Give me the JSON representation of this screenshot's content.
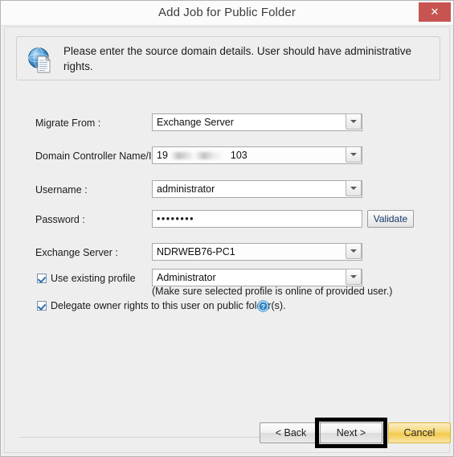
{
  "window": {
    "title": "Add Job for Public Folder",
    "close_label": "✕",
    "close_icon": "close-icon"
  },
  "banner": {
    "icon": "globe-document-icon",
    "text": "Please enter the source domain details. User should have administrative rights."
  },
  "form": {
    "fields": [
      {
        "name": "migrate-from",
        "label": "Migrate From :",
        "value": "Exchange Server",
        "type": "combobox"
      },
      {
        "name": "domain-controller",
        "label": "Domain Controller Name/IP :",
        "value_prefix": "19",
        "value_suffix": "103",
        "value_redacted": true,
        "type": "combobox"
      },
      {
        "name": "username",
        "label": "Username :",
        "value": "administrator",
        "type": "combobox"
      },
      {
        "name": "password",
        "label": "Password :",
        "value": "••••••••",
        "type": "password"
      },
      {
        "name": "exchange-server",
        "label": "Exchange Server :",
        "value": "NDRWEB76-PC1",
        "type": "combobox"
      }
    ],
    "validate_button": "Validate",
    "use_existing_profile": {
      "label": "Use existing profile",
      "checked": true,
      "value": "Administrator"
    },
    "profile_hint": "(Make sure selected profile is online of provided user.)",
    "delegate_rights": {
      "label": "Delegate owner rights to this user on public folder(s).",
      "checked": true
    },
    "help_icon": "help-icon",
    "help_glyph": "?"
  },
  "footer": {
    "back_label": "< Back",
    "next_label": "Next >",
    "cancel_label": "Cancel",
    "next_highlighted": true
  },
  "colors": {
    "close_red": "#c75450",
    "cancel_yellow": "#f2c94c",
    "highlight_black": "#000000",
    "dialog_bg": "#eeeeee"
  }
}
